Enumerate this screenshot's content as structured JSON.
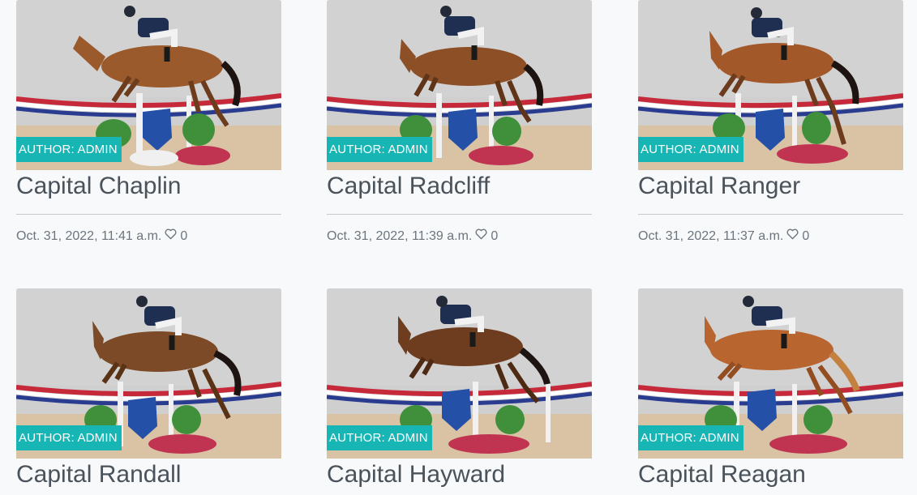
{
  "posts": [
    {
      "title": "Capital Chaplin",
      "author": "AUTHOR: ADMIN",
      "date": "Oct. 31, 2022, 11:41 a.m.",
      "likes": "0"
    },
    {
      "title": "Capital Radcliff",
      "author": "AUTHOR: ADMIN",
      "date": "Oct. 31, 2022, 11:39 a.m.",
      "likes": "0"
    },
    {
      "title": "Capital Ranger",
      "author": "AUTHOR: ADMIN",
      "date": "Oct. 31, 2022, 11:37 a.m.",
      "likes": "0"
    },
    {
      "title": "Capital Randall",
      "author": "AUTHOR: ADMIN",
      "date": "",
      "likes": ""
    },
    {
      "title": "Capital Hayward",
      "author": "AUTHOR: ADMIN",
      "date": "",
      "likes": ""
    },
    {
      "title": "Capital Reagan",
      "author": "AUTHOR: ADMIN",
      "date": "",
      "likes": ""
    }
  ],
  "colors": {
    "badge": "#18b5b5",
    "title": "#4a535b",
    "meta": "#6c757d",
    "background": "#f8f9fa"
  },
  "icons": {
    "likes": "heart-outline-icon"
  }
}
